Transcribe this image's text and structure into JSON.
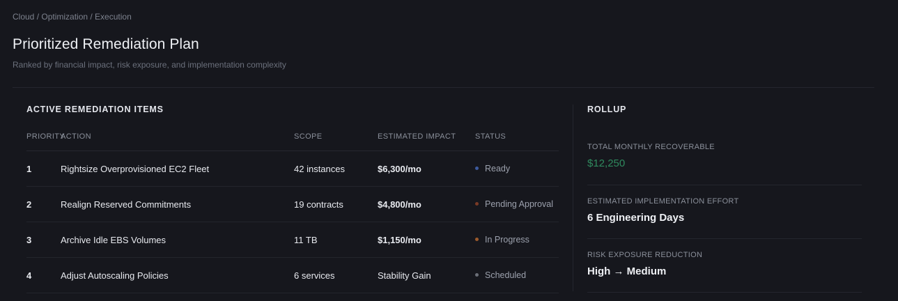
{
  "breadcrumb": "Cloud / Optimization / Execution",
  "title": "Prioritized Remediation Plan",
  "subtitle": "Ranked by financial impact, risk exposure, and implementation complexity",
  "items_section": {
    "title": "ACTIVE REMEDIATION ITEMS",
    "columns": {
      "priority": "PRIORITY",
      "action": "ACTION",
      "scope": "SCOPE",
      "impact": "ESTIMATED IMPACT",
      "status": "STATUS"
    },
    "rows": [
      {
        "priority": "1",
        "action": "Rightsize Overprovisioned EC2 Fleet",
        "scope": "42 instances",
        "impact": "$6,300/mo",
        "status": "Ready",
        "status_color": "#3d5a9e"
      },
      {
        "priority": "2",
        "action": "Realign Reserved Commitments",
        "scope": "19 contracts",
        "impact": "$4,800/mo",
        "status": "Pending Approval",
        "status_color": "#7a3a26"
      },
      {
        "priority": "3",
        "action": "Archive Idle EBS Volumes",
        "scope": "11 TB",
        "impact": "$1,150/mo",
        "status": "In Progress",
        "status_color": "#9c5a2c"
      },
      {
        "priority": "4",
        "action": "Adjust Autoscaling Policies",
        "scope": "6 services",
        "impact": "Stability Gain",
        "status": "Scheduled",
        "status_color": "#6b6f78"
      }
    ]
  },
  "rollup": {
    "title": "ROLLUP",
    "metrics": [
      {
        "label": "TOTAL MONTHLY RECOVERABLE",
        "value": "$12,250"
      },
      {
        "label": "ESTIMATED IMPLEMENTATION EFFORT",
        "value": "6 Engineering Days"
      },
      {
        "label": "RISK EXPOSURE REDUCTION",
        "value": "High → Medium"
      }
    ]
  },
  "colors": {
    "background": "#16171d",
    "recoverable_green": "#2f8a5e"
  }
}
